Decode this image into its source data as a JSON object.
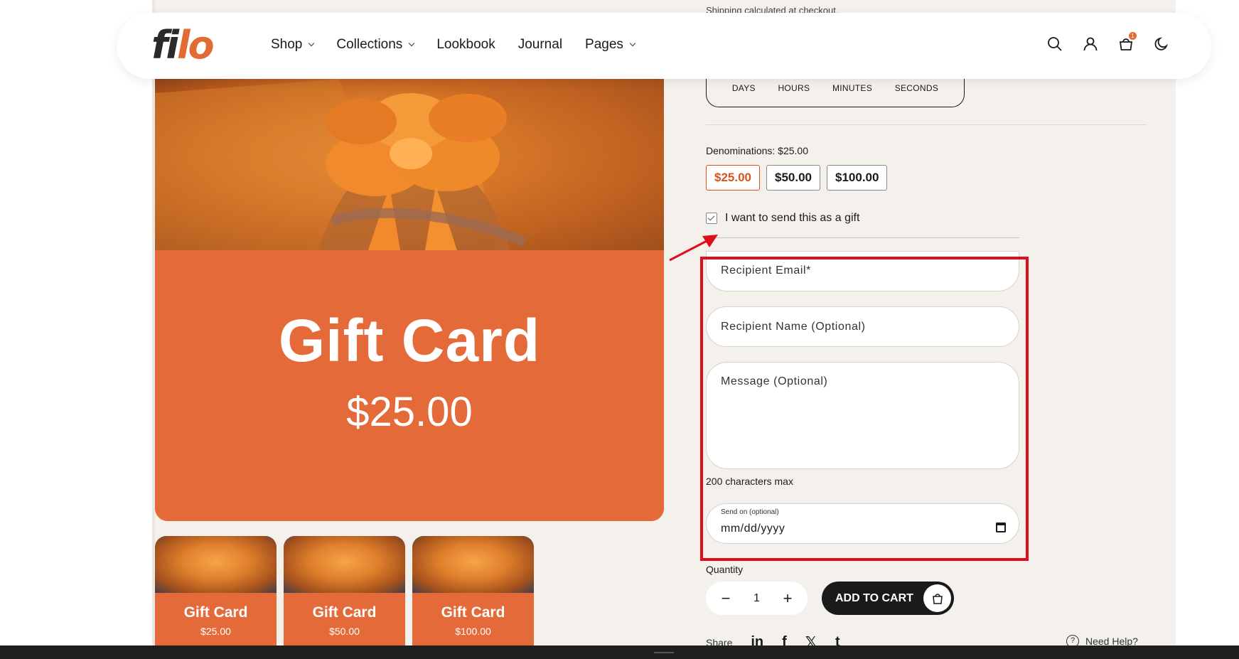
{
  "brand": {
    "logo_part1": "fi",
    "logo_part2": "lo"
  },
  "nav": [
    {
      "label": "Shop",
      "dropdown": true
    },
    {
      "label": "Collections",
      "dropdown": true
    },
    {
      "label": "Lookbook",
      "dropdown": false
    },
    {
      "label": "Journal",
      "dropdown": false
    },
    {
      "label": "Pages",
      "dropdown": true
    }
  ],
  "header_icons": [
    "search-icon",
    "account-icon",
    "cart-icon",
    "theme-toggle-icon"
  ],
  "cart_count": "1",
  "shipping_note": "Shipping calculated at checkout.",
  "countdown": {
    "labels": [
      "DAYS",
      "HOURS",
      "MINUTES",
      "SECONDS"
    ]
  },
  "product": {
    "hero_title": "Gift Card",
    "hero_price": "$25.00",
    "thumbnails": [
      {
        "title": "Gift Card",
        "price": "$25.00"
      },
      {
        "title": "Gift Card",
        "price": "$50.00"
      },
      {
        "title": "Gift Card",
        "price": "$100.00"
      }
    ]
  },
  "denominations": {
    "label": "Denominations: $25.00",
    "options": [
      "$25.00",
      "$50.00",
      "$100.00"
    ],
    "selected": "$25.00"
  },
  "gift": {
    "checkbox_label": "I want to send this as a gift",
    "checked": true
  },
  "form": {
    "recipient_email_placeholder": "Recipient Email*",
    "recipient_name_placeholder": "Recipient Name (Optional)",
    "message_placeholder": "Message (Optional)",
    "chars_note": "200 characters max",
    "send_on_label": "Send on (optional)",
    "send_on_value": "mm/dd/yyyy"
  },
  "quantity": {
    "label": "Quantity",
    "value": "1",
    "minus": "−",
    "plus": "+"
  },
  "add_to_cart_label": "ADD TO CART",
  "share": {
    "label": "Share",
    "icons": [
      "in",
      "f",
      "𝕏",
      "t"
    ]
  },
  "help_label": "Need Help?",
  "colors": {
    "accent": "#e46a39",
    "annotation": "#dd0f1a",
    "dark": "#1a1a1a"
  }
}
